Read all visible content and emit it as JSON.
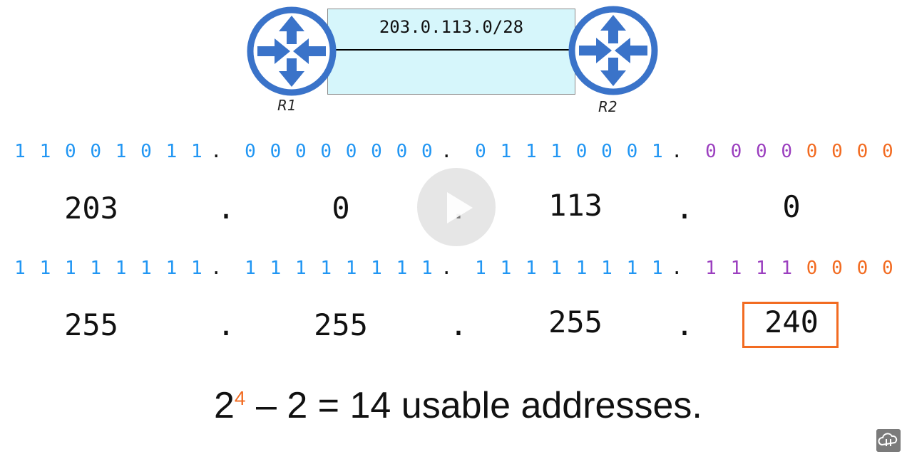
{
  "diagram": {
    "subnet": "203.0.113.0/28",
    "routers": [
      {
        "label": "R1"
      },
      {
        "label": "R2"
      }
    ],
    "colors": {
      "router": "#3a73c9",
      "network_bits": "#2196f3",
      "borrowed_bits": "#9b3fbf",
      "host_bits": "#f26b21",
      "box_fill": "#d6f6fb"
    }
  },
  "address": {
    "binary": [
      [
        "1",
        "1",
        "0",
        "0",
        "1",
        "0",
        "1",
        "1"
      ],
      [
        "0",
        "0",
        "0",
        "0",
        "0",
        "0",
        "0",
        "0"
      ],
      [
        "0",
        "1",
        "1",
        "1",
        "0",
        "0",
        "0",
        "1"
      ],
      [
        "0",
        "0",
        "0",
        "0",
        "0",
        "0",
        "0",
        "0"
      ]
    ],
    "decimal": [
      "203",
      "0",
      "113",
      "0"
    ]
  },
  "mask": {
    "binary": [
      [
        "1",
        "1",
        "1",
        "1",
        "1",
        "1",
        "1",
        "1"
      ],
      [
        "1",
        "1",
        "1",
        "1",
        "1",
        "1",
        "1",
        "1"
      ],
      [
        "1",
        "1",
        "1",
        "1",
        "1",
        "1",
        "1",
        "1"
      ],
      [
        "1",
        "1",
        "1",
        "1",
        "0",
        "0",
        "0",
        "0"
      ]
    ],
    "decimal": [
      "255",
      "255",
      "255",
      "240"
    ]
  },
  "separator": ".",
  "formula": {
    "base": "2",
    "exponent": "4",
    "rest": " – 2 = 14 usable addresses."
  },
  "video": {
    "play_icon": "play-icon",
    "logo_icon": "cloud-logo-icon"
  }
}
